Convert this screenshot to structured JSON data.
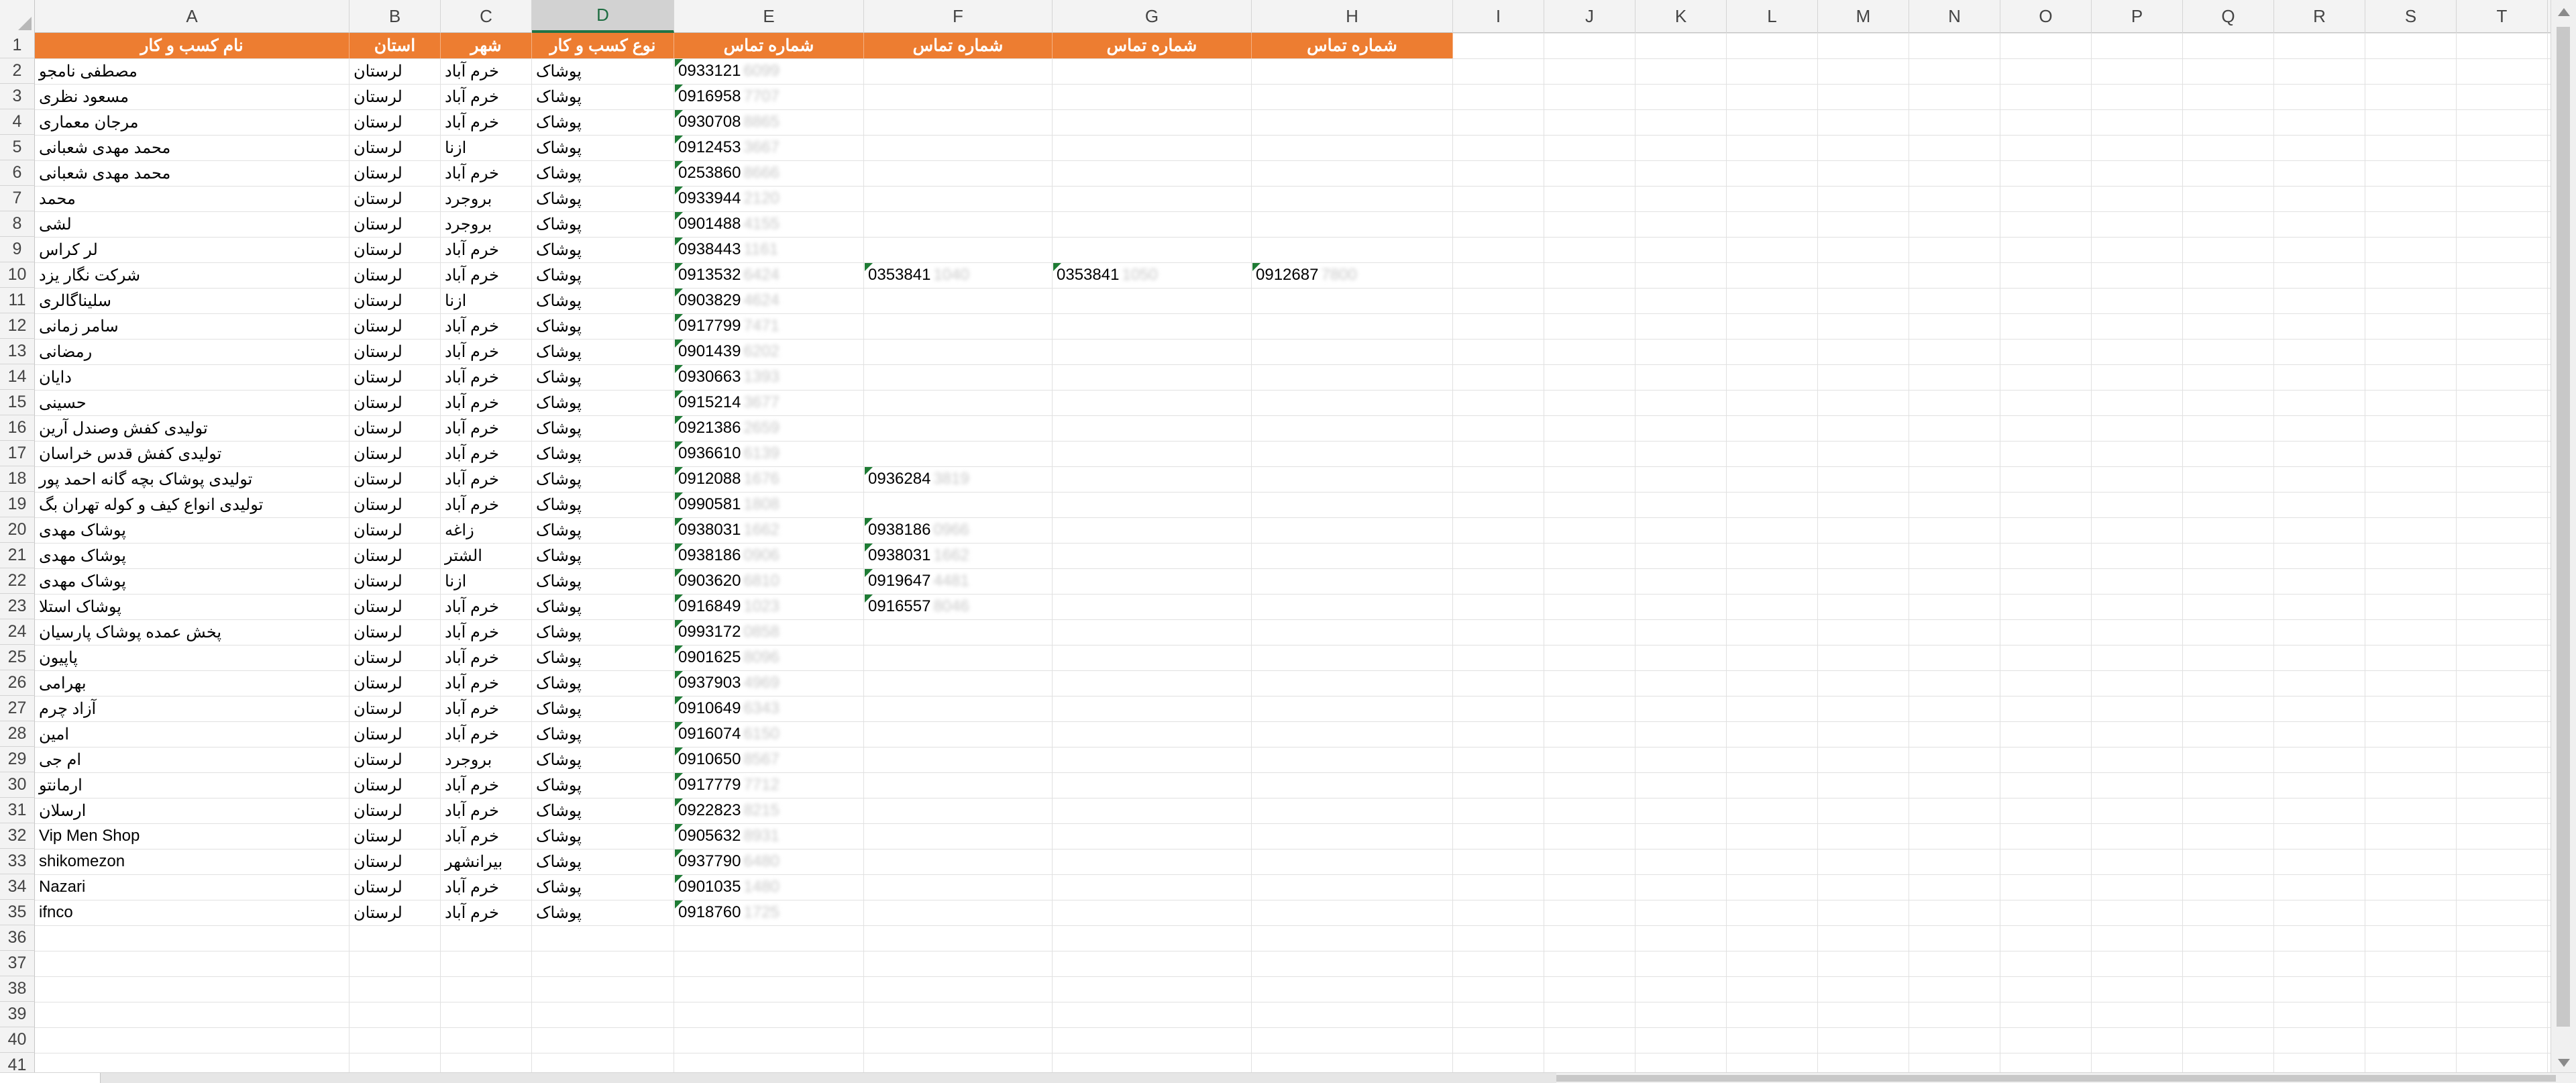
{
  "columns": [
    "A",
    "B",
    "C",
    "D",
    "E",
    "F",
    "G",
    "H",
    "I",
    "J",
    "K",
    "L",
    "M",
    "N",
    "O",
    "P",
    "Q",
    "R",
    "S",
    "T"
  ],
  "selected_column": "D",
  "header_row": {
    "A": "نام کسب و کار",
    "B": "استان",
    "C": "شهر",
    "D": "نوع کسب و کار",
    "E": "شماره تماس",
    "F": "شماره تماس",
    "G": "شماره تماس",
    "H": "شماره تماس"
  },
  "rows": [
    {
      "n": "2",
      "A": "مصطفی نامجو",
      "B": "لرستان",
      "C": "خرم آباد",
      "D": "پوشاک",
      "E": "0933121",
      "E_hidden": "6099"
    },
    {
      "n": "3",
      "A": "مسعود نظری",
      "B": "لرستان",
      "C": "خرم آباد",
      "D": "پوشاک",
      "E": "0916958",
      "E_hidden": "7707"
    },
    {
      "n": "4",
      "A": "مرجان معماری",
      "B": "لرستان",
      "C": "خرم آباد",
      "D": "پوشاک",
      "E": "0930708",
      "E_hidden": "8865"
    },
    {
      "n": "5",
      "A": "محمد مهدی شعبانی",
      "B": "لرستان",
      "C": "ازنا",
      "D": "پوشاک",
      "E": "0912453",
      "E_hidden": "3667"
    },
    {
      "n": "6",
      "A": "محمد مهدی شعبانی",
      "B": "لرستان",
      "C": "خرم آباد",
      "D": "پوشاک",
      "E": "0253860",
      "E_hidden": "8666"
    },
    {
      "n": "7",
      "A": "محمد",
      "B": "لرستان",
      "C": "بروجرد",
      "D": "پوشاک",
      "E": "0933944",
      "E_hidden": "2120"
    },
    {
      "n": "8",
      "A": "لشی",
      "B": "لرستان",
      "C": "بروجرد",
      "D": "پوشاک",
      "E": "0901488",
      "E_hidden": "4155"
    },
    {
      "n": "9",
      "A": "لر کراس",
      "B": "لرستان",
      "C": "خرم آباد",
      "D": "پوشاک",
      "E": "0938443",
      "E_hidden": "1161"
    },
    {
      "n": "10",
      "A": "شرکت نگار یزد",
      "B": "لرستان",
      "C": "خرم آباد",
      "D": "پوشاک",
      "E": "0913532",
      "E_hidden": "6424",
      "F": "0353841",
      "F_hidden": "1040",
      "G": "0353841",
      "G_hidden": "1050",
      "H": "0912687",
      "H_hidden": "7800"
    },
    {
      "n": "11",
      "A": "سلیناگالری",
      "B": "لرستان",
      "C": "ازنا",
      "D": "پوشاک",
      "E": "0903829",
      "E_hidden": "4624"
    },
    {
      "n": "12",
      "A": "سامر زمانی",
      "B": "لرستان",
      "C": "خرم آباد",
      "D": "پوشاک",
      "E": "0917799",
      "E_hidden": "7471"
    },
    {
      "n": "13",
      "A": "رمضانی",
      "B": "لرستان",
      "C": "خرم آباد",
      "D": "پوشاک",
      "E": "0901439",
      "E_hidden": "6202"
    },
    {
      "n": "14",
      "A": "دایان",
      "B": "لرستان",
      "C": "خرم آباد",
      "D": "پوشاک",
      "E": "0930663",
      "E_hidden": "1393"
    },
    {
      "n": "15",
      "A": "حسینی",
      "B": "لرستان",
      "C": "خرم آباد",
      "D": "پوشاک",
      "E": "0915214",
      "E_hidden": "3677"
    },
    {
      "n": "16",
      "A": "تولیدی کفش وصندل آرین",
      "B": "لرستان",
      "C": "خرم آباد",
      "D": "پوشاک",
      "E": "0921386",
      "E_hidden": "2659"
    },
    {
      "n": "17",
      "A": "تولیدی کفش قدس خراسان",
      "B": "لرستان",
      "C": "خرم آباد",
      "D": "پوشاک",
      "E": "0936610",
      "E_hidden": "6139"
    },
    {
      "n": "18",
      "A": "تولیدی پوشاک بچه گانه  احمد پور",
      "B": "لرستان",
      "C": "خرم آباد",
      "D": "پوشاک",
      "E": "0912088",
      "E_hidden": "1676",
      "F": "0936284",
      "F_hidden": "3819"
    },
    {
      "n": "19",
      "A": "تولیدی انواع کیف و کوله  تهران بگ",
      "B": "لرستان",
      "C": "خرم آباد",
      "D": "پوشاک",
      "E": "0990581",
      "E_hidden": "1808"
    },
    {
      "n": "20",
      "A": "پوشاک مهدی",
      "B": "لرستان",
      "C": "زاغه",
      "D": "پوشاک",
      "E": "0938031",
      "E_hidden": "1662",
      "F": "0938186",
      "F_hidden": "0966"
    },
    {
      "n": "21",
      "A": "پوشاک مهدی",
      "B": "لرستان",
      "C": "الشتر",
      "D": "پوشاک",
      "E": "0938186",
      "E_hidden": "0906",
      "F": "0938031",
      "F_hidden": "1662"
    },
    {
      "n": "22",
      "A": "پوشاک مهدی",
      "B": "لرستان",
      "C": "ازنا",
      "D": "پوشاک",
      "E": "0903620",
      "E_hidden": "6810",
      "F": "0919647",
      "F_hidden": "4481"
    },
    {
      "n": "23",
      "A": "پوشاک استلا",
      "B": "لرستان",
      "C": "خرم آباد",
      "D": "پوشاک",
      "E": "0916849",
      "E_hidden": "1023",
      "F": "0916557",
      "F_hidden": "8046"
    },
    {
      "n": "24",
      "A": "پخش عمده پوشاک پارسیان",
      "B": "لرستان",
      "C": "خرم آباد",
      "D": "پوشاک",
      "E": "0993172",
      "E_hidden": "0858"
    },
    {
      "n": "25",
      "A": "پاپیون",
      "B": "لرستان",
      "C": "خرم آباد",
      "D": "پوشاک",
      "E": "0901625",
      "E_hidden": "8096"
    },
    {
      "n": "26",
      "A": "بهرامی",
      "B": "لرستان",
      "C": "خرم آباد",
      "D": "پوشاک",
      "E": "0937903",
      "E_hidden": "4969"
    },
    {
      "n": "27",
      "A": "آزاد چرم",
      "B": "لرستان",
      "C": "خرم آباد",
      "D": "پوشاک",
      "E": "0910649",
      "E_hidden": "6343"
    },
    {
      "n": "28",
      "A": "امین",
      "B": "لرستان",
      "C": "خرم آباد",
      "D": "پوشاک",
      "E": "0916074",
      "E_hidden": "6150"
    },
    {
      "n": "29",
      "A": "ام جی",
      "B": "لرستان",
      "C": "بروجرد",
      "D": "پوشاک",
      "E": "0910650",
      "E_hidden": "8567"
    },
    {
      "n": "30",
      "A": "ارمانتو",
      "B": "لرستان",
      "C": "خرم آباد",
      "D": "پوشاک",
      "E": "0917779",
      "E_hidden": "7712"
    },
    {
      "n": "31",
      "A": "ارسلان",
      "B": "لرستان",
      "C": "خرم آباد",
      "D": "پوشاک",
      "E": "0922823",
      "E_hidden": "8215"
    },
    {
      "n": "32",
      "A": "Vip Men Shop",
      "B": "لرستان",
      "C": "خرم آباد",
      "D": "پوشاک",
      "E": "0905632",
      "E_hidden": "8931"
    },
    {
      "n": "33",
      "A": "shikomezon",
      "B": "لرستان",
      "C": "بیرانشهر",
      "D": "پوشاک",
      "E": "0937790",
      "E_hidden": "6480"
    },
    {
      "n": "34",
      "A": "Nazari",
      "B": "لرستان",
      "C": "خرم آباد",
      "D": "پوشاک",
      "E": "0901035",
      "E_hidden": "1480"
    },
    {
      "n": "35",
      "A": "ifnco",
      "B": "لرستان",
      "C": "خرم آباد",
      "D": "پوشاک",
      "E": "0918760",
      "E_hidden": "1725"
    }
  ],
  "row_numbers": [
    "1",
    "2",
    "3",
    "4",
    "5",
    "6",
    "7",
    "8",
    "9",
    "10",
    "11",
    "12",
    "13",
    "14",
    "15",
    "16",
    "17",
    "18",
    "19",
    "20",
    "21",
    "22",
    "23",
    "24",
    "25",
    "26",
    "27",
    "28",
    "29",
    "30",
    "31",
    "32",
    "33",
    "34",
    "35",
    "36",
    "37",
    "38",
    "39",
    "40",
    "41"
  ],
  "colors": {
    "header_fill": "#ed7d31",
    "header_text": "#ffffff",
    "selected_col_accent": "#217346",
    "number_as_text_flag": "#1e7b34"
  },
  "icons": {
    "select_all": "select-all-triangle-icon",
    "scroll_up": "arrow-up-icon",
    "scroll_down": "arrow-down-icon",
    "text_number_flag": "green-triangle-icon"
  }
}
